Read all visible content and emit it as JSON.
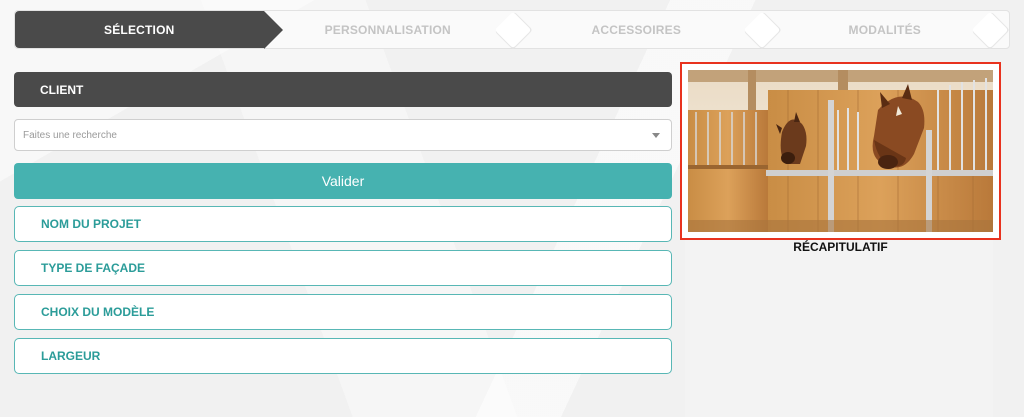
{
  "stepper": {
    "steps": [
      {
        "label": "SÉLECTION",
        "active": true
      },
      {
        "label": "PERSONNALISATION",
        "active": false
      },
      {
        "label": "ACCESSOIRES",
        "active": false
      },
      {
        "label": "MODALITÉS",
        "active": false
      }
    ]
  },
  "form": {
    "client_label": "CLIENT",
    "search_placeholder": "Faites une recherche",
    "validate_label": "Valider",
    "fields": [
      "NOM DU PROJET",
      "TYPE DE FAÇADE",
      "CHOIX DU MODÈLE",
      "LARGEUR"
    ]
  },
  "summary": {
    "title": "RÉCAPITULATIF",
    "highlight_color": "#e8321e"
  },
  "colors": {
    "dark": "#4a4a4a",
    "teal": "#46b2b0",
    "teal_text": "#2b9c99"
  }
}
